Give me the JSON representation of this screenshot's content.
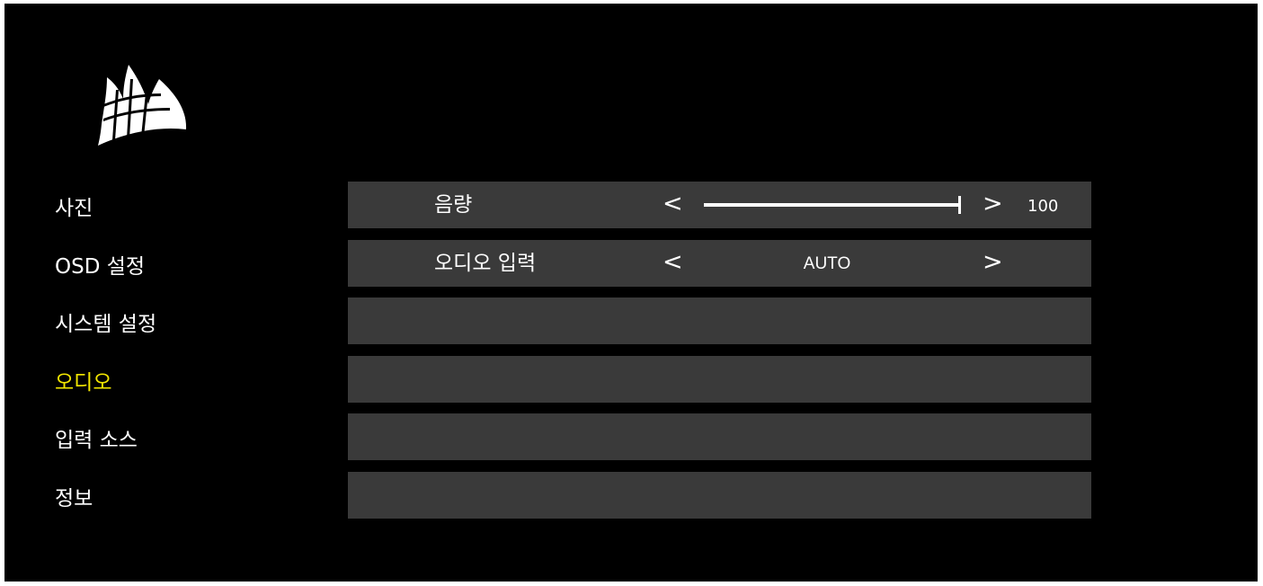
{
  "menu": {
    "items": [
      {
        "label": "사진"
      },
      {
        "label": "OSD 설정"
      },
      {
        "label": "시스템 설정"
      },
      {
        "label": "오디오",
        "active": true
      },
      {
        "label": "입력 소스"
      },
      {
        "label": "정보"
      }
    ]
  },
  "settings": {
    "volume": {
      "label": "음량",
      "left_arrow": "<",
      "right_arrow": ">",
      "value": "100",
      "level": 100,
      "max": 100
    },
    "audio_input": {
      "label": "오디오 입력",
      "left_arrow": "<",
      "right_arrow": ">",
      "value": "AUTO"
    }
  },
  "icons": {
    "logo": "corsair-sails-logo",
    "slider": "volume-slider"
  },
  "colors": {
    "background": "#000000",
    "row_background": "#3a3a3a",
    "text": "#ffffff",
    "active_menu": "#f2e600"
  }
}
